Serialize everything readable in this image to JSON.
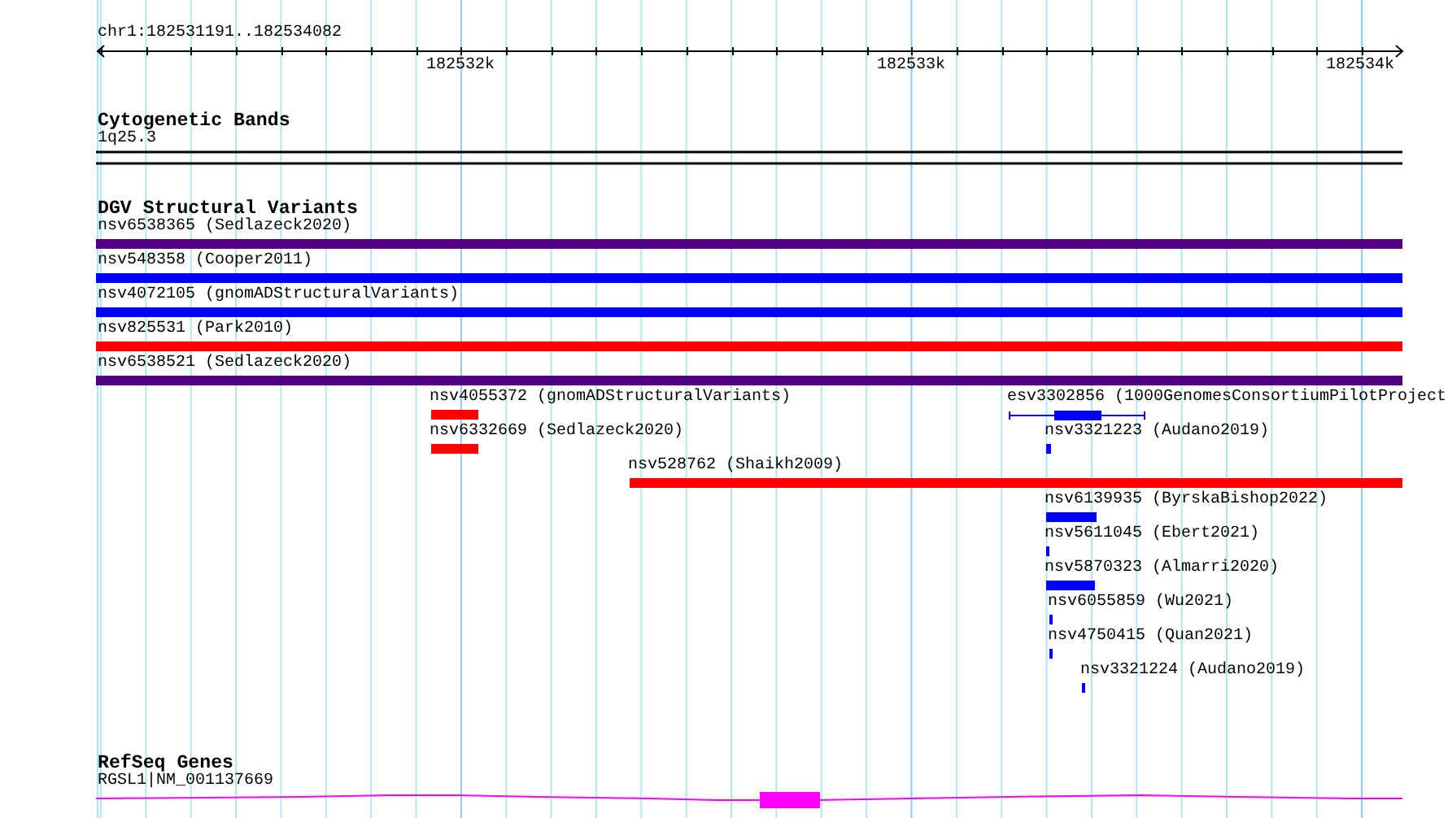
{
  "ruler": {
    "position": "chr1:182531191..182534082",
    "ticks": [
      "182532k",
      "182533k",
      "182534k"
    ]
  },
  "tracks": [
    {
      "title": "Cytogenetic Bands",
      "kind": "bands",
      "items": [
        {
          "label": "1q25.3"
        }
      ]
    },
    {
      "title": "DGV Structural Variants",
      "kind": "variants",
      "items": [
        {
          "label": "nsv6538365 (Sedlazeck2020)",
          "kind": "bar",
          "color": "#500080"
        },
        {
          "label": "nsv548358 (Cooper2011)",
          "kind": "bar",
          "color": "#0000ff"
        },
        {
          "label": "nsv4072105 (gnomADStructuralVariants)",
          "kind": "bar",
          "color": "#0000ff"
        },
        {
          "label": "nsv825531 (Park2010)",
          "kind": "bar",
          "color": "#ff0000"
        },
        {
          "label": "nsv6538521 (Sedlazeck2020)",
          "kind": "bar",
          "color": "#500080"
        },
        {
          "label": "nsv4055372 (gnomADStructuralVariants)",
          "kind": "bar",
          "color": "#ff0000"
        },
        {
          "label": "esv3302856 (1000GenomesConsortiumPilotProject",
          "kind": "linked",
          "color": "#0000ff"
        },
        {
          "label": "nsv6332669 (Sedlazeck2020)",
          "kind": "bar",
          "color": "#ff0000"
        },
        {
          "label": "nsv3321223 (Audano2019)",
          "kind": "bar",
          "color": "#0000ff"
        },
        {
          "label": "nsv528762 (Shaikh2009)",
          "kind": "bar",
          "color": "#ff0000"
        },
        {
          "label": "nsv6139935 (ByrskaBishop2022)",
          "kind": "bar",
          "color": "#0000ff"
        },
        {
          "label": "nsv5611045 (Ebert2021)",
          "kind": "bar",
          "color": "#0000ff"
        },
        {
          "label": "nsv5870323 (Almarri2020)",
          "kind": "bar",
          "color": "#0000ff"
        },
        {
          "label": "nsv6055859 (Wu2021)",
          "kind": "bar",
          "color": "#0000ff"
        },
        {
          "label": "nsv4750415 (Quan2021)",
          "kind": "bar",
          "color": "#0000ff"
        },
        {
          "label": "nsv3321224 (Audano2019)",
          "kind": "bar",
          "color": "#0000ff"
        }
      ]
    },
    {
      "title": "RefSeq Genes",
      "kind": "genes",
      "items": [
        {
          "label": "RGSL1|NM_001137669"
        }
      ]
    }
  ]
}
